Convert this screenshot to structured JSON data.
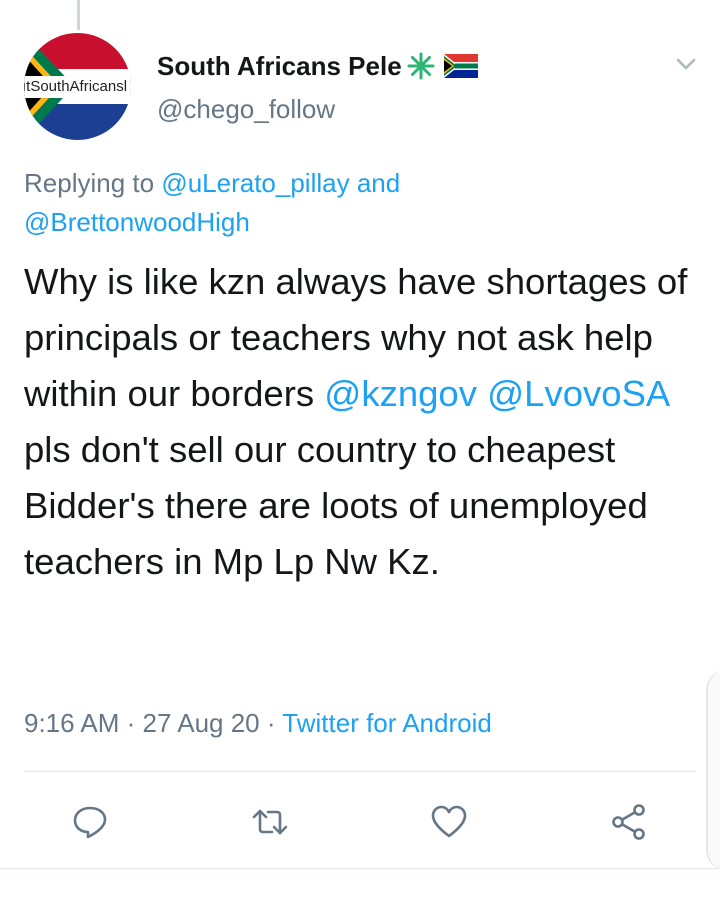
{
  "tweet": {
    "avatar_text": "ıtSouthAfricansl",
    "display_name": "South Africans Pele",
    "handle": "@chego_follow",
    "replying_prefix": "Replying to ",
    "replying_to_1": "@uLerato_pillay",
    "replying_and": " and",
    "replying_to_2": "@BrettonwoodHigh",
    "text_1": "Why is like kzn always have shortages of principals or teachers why not ask help within our borders ",
    "mention_1": "@kzngov",
    "text_space": " ",
    "mention_2": "@LvovoSA",
    "text_2": " pls don't sell our country to cheapest Bidder's there are loots of unemployed teachers in Mp Lp Nw Kz.",
    "time": "9:16 AM",
    "separator": " · ",
    "date": "27 Aug 20",
    "source": "Twitter for Android"
  },
  "icons": {
    "menu": "chevron-down-icon",
    "reply": "reply-icon",
    "retweet": "retweet-icon",
    "like": "heart-icon",
    "share": "share-icon",
    "badge_1": "sparkle-icon",
    "badge_2": "south-africa-flag-icon"
  },
  "colors": {
    "link": "#1da1f2",
    "secondary_text": "#657786",
    "primary_text": "#14171a",
    "icon": "#657786"
  }
}
